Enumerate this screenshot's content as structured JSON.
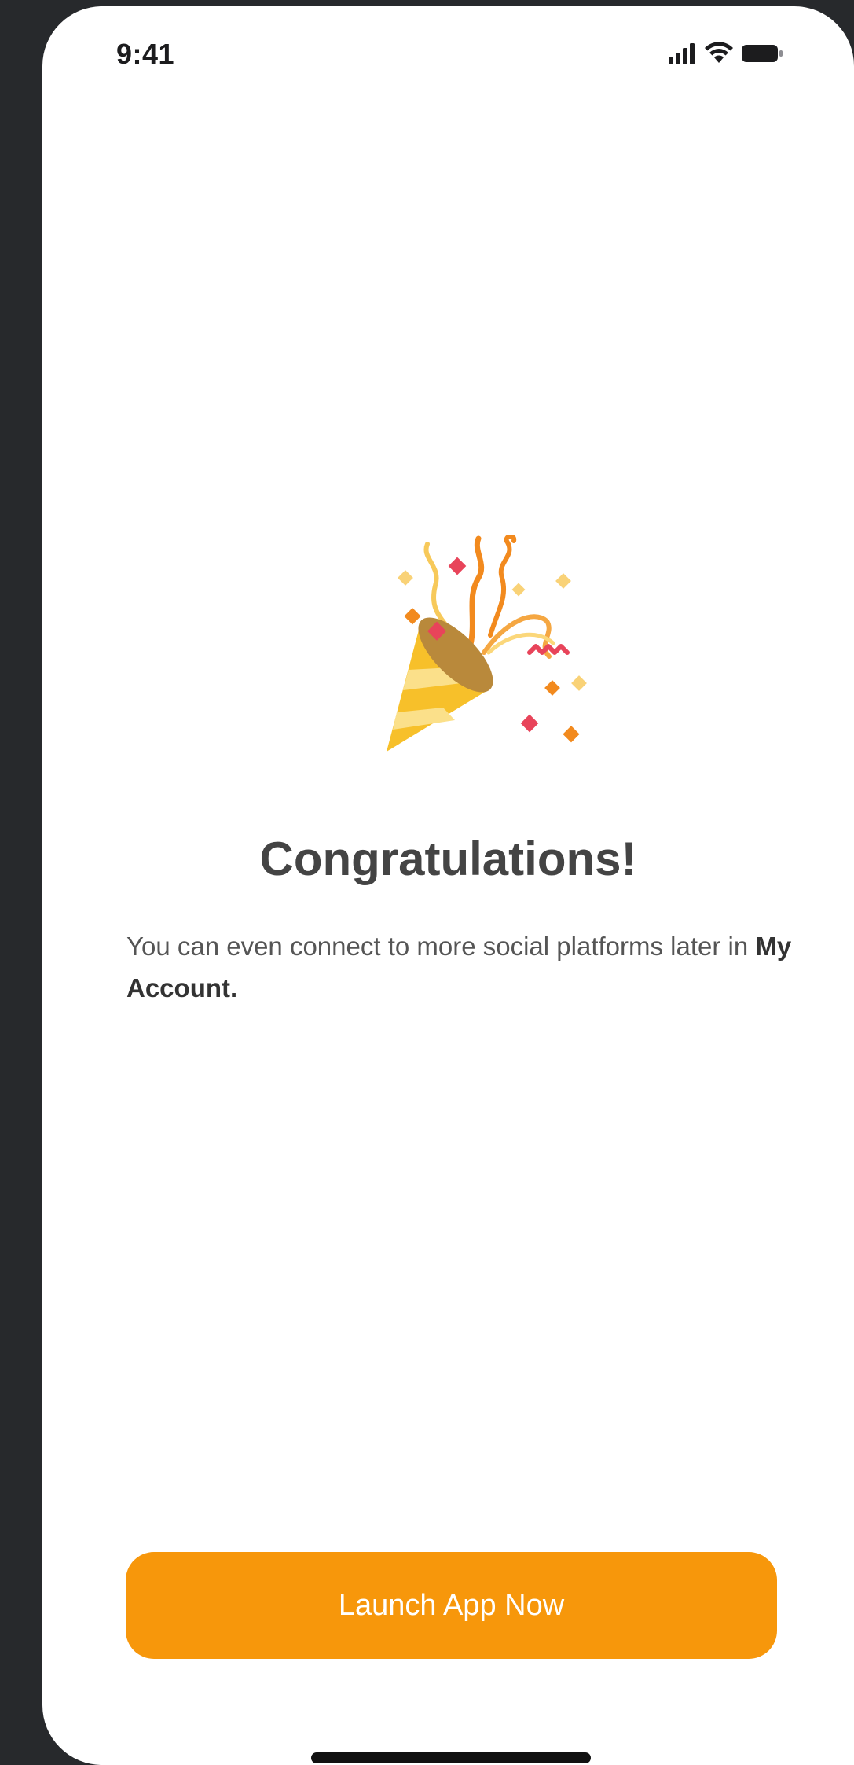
{
  "status_bar": {
    "time": "9:41",
    "signal_icon": "cellular-signal-icon",
    "wifi_icon": "wifi-icon",
    "battery_icon": "battery-icon"
  },
  "illustration": {
    "icon": "party-popper-icon"
  },
  "main": {
    "title": "Congratulations!",
    "message_prefix": "You can even connect to more social platforms later in ",
    "message_emphasis": "My Account."
  },
  "actions": {
    "launch_label": "Launch App Now"
  },
  "colors": {
    "accent": "#f7970b",
    "background": "#ffffff",
    "frame": "#27292c",
    "title": "#444444",
    "body_text": "#555555"
  }
}
